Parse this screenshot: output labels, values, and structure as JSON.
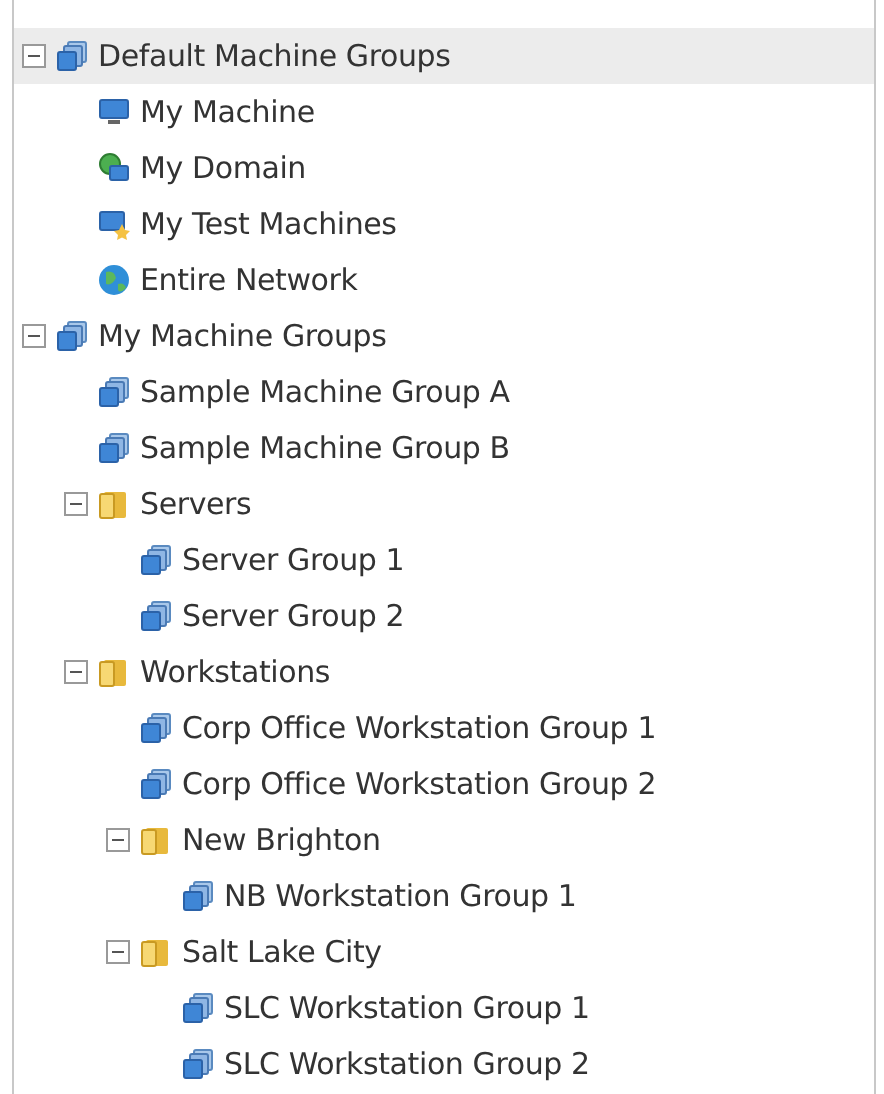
{
  "tree": [
    {
      "label": "Default Machine Groups",
      "kind": "group",
      "expanded": true,
      "selected": true,
      "children": [
        {
          "label": "My Machine",
          "kind": "machine",
          "selected": false
        },
        {
          "label": "My Domain",
          "kind": "domain",
          "selected": false
        },
        {
          "label": "My Test Machines",
          "kind": "test",
          "selected": false
        },
        {
          "label": "Entire Network",
          "kind": "network",
          "selected": false
        }
      ]
    },
    {
      "label": "My Machine Groups",
      "kind": "group",
      "expanded": true,
      "selected": false,
      "children": [
        {
          "label": "Sample Machine Group A",
          "kind": "group",
          "selected": false
        },
        {
          "label": "Sample Machine Group B",
          "kind": "group",
          "selected": false
        },
        {
          "label": "Servers",
          "kind": "folder",
          "expanded": true,
          "selected": false,
          "children": [
            {
              "label": "Server Group 1",
              "kind": "group",
              "selected": false
            },
            {
              "label": "Server Group 2",
              "kind": "group",
              "selected": false
            }
          ]
        },
        {
          "label": "Workstations",
          "kind": "folder",
          "expanded": true,
          "selected": false,
          "children": [
            {
              "label": "Corp Office Workstation Group 1",
              "kind": "group",
              "selected": false
            },
            {
              "label": "Corp Office Workstation Group 2",
              "kind": "group",
              "selected": false
            },
            {
              "label": "New Brighton",
              "kind": "folder",
              "expanded": true,
              "selected": false,
              "children": [
                {
                  "label": "NB Workstation Group 1",
                  "kind": "group",
                  "selected": false
                }
              ]
            },
            {
              "label": "Salt Lake City",
              "kind": "folder",
              "expanded": true,
              "selected": false,
              "children": [
                {
                  "label": "SLC Workstation Group 1",
                  "kind": "group",
                  "selected": false
                },
                {
                  "label": "SLC Workstation Group 2",
                  "kind": "group",
                  "selected": false
                }
              ]
            }
          ]
        }
      ]
    }
  ]
}
